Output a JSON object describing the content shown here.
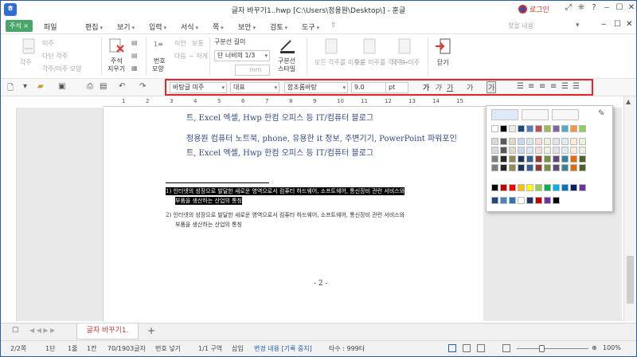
{
  "window": {
    "title": "글자 바꾸기1..hwp [C:\\Users\\정용원\\Desktop\\] - 훈글",
    "login_label": "로그인",
    "controls": [
      "✕⁄",
      "⋮",
      "?",
      "‒",
      "☐",
      "✕"
    ],
    "sub_controls": [
      "‒",
      "☐",
      "✕"
    ]
  },
  "menu": {
    "badge": "주석 ×",
    "items": [
      "파일",
      "편집",
      "보기",
      "입력",
      "서식",
      "쪽",
      "보안",
      "검토",
      "도구"
    ],
    "search_placeholder": "찾을 내용"
  },
  "ribbon": {
    "g1": [
      "각주",
      "미주",
      "다단 각주",
      "각주/미주 모양"
    ],
    "g2": [
      "주석",
      "지우기"
    ],
    "g3": [
      "번호",
      "모양",
      "이전",
      "다음",
      "보통",
      "~ 저게"
    ],
    "divider_length_label": "구분선 길이",
    "divider_length_value": "단 너비의 1/3",
    "mm_label": "mm",
    "divider_style": [
      "구분선",
      "스타일"
    ],
    "g4": [
      "모든 각주를 미주로",
      "모든 미주를 각주로",
      "각주↔미주"
    ],
    "close_label": "닫기"
  },
  "toolbar": {
    "style": "바탕글 미주",
    "lang": "대표",
    "font": "함초롬바탕",
    "size": "9.0",
    "unit": "pt",
    "format_icons": [
      "가",
      "가",
      "가",
      "가",
      "가"
    ]
  },
  "ruler": {
    "numbers": [
      "1",
      "2",
      "3",
      "4",
      "5",
      "6",
      "7",
      "8",
      "9",
      "10",
      "11",
      "12",
      "13",
      "14",
      "15"
    ]
  },
  "document": {
    "line1": "트, Excel 엑셀, Hwp 한컴 오피스 등 IT/컴퓨터 블로그",
    "line2": "정용원 컴퓨터 노트북, phone, 유용한 it 정보, 주변기기, PowerPoint 파워포인",
    "line3": "트, Excel 엑셀, Hwp 한컴 오피스 등 IT/컴퓨터 블로그",
    "fn1_a": "1) 인터넷의 성장으로 발달한 새로운 영역으로서 컴퓨터 하드웨어, 소프트웨어, 통신장비 관련 서비스와",
    "fn1_b": "부품을 생산하는 산업의 통칭",
    "fn2_a": "2) 인터넷의 성장으로 발달한 새로운 영역으로서 컴퓨터 하드웨어, 소프트웨어, 통신장비 관련 서비스와",
    "fn2_b": "부품을 생산하는 산업의 통칭",
    "page_num": "- 2 -"
  },
  "tabs": {
    "doc_tab": "글자 바꾸기1.",
    "add": "+"
  },
  "status": {
    "page": "2/2쪽",
    "col": "1단",
    "line": "1줄",
    "ch": "1칸",
    "chars": "70/1903글자",
    "insert_num": "번호 넣기",
    "section": "1/1 구역",
    "mode": "삽입",
    "track": "변경 내용 [기록 중지]",
    "typing": "타수 : 999타",
    "zoom": "100%"
  },
  "colors": {
    "accent_red": "#e0282e",
    "blue_text": "#2f4a8a",
    "green_badge": "#4aa56b"
  }
}
